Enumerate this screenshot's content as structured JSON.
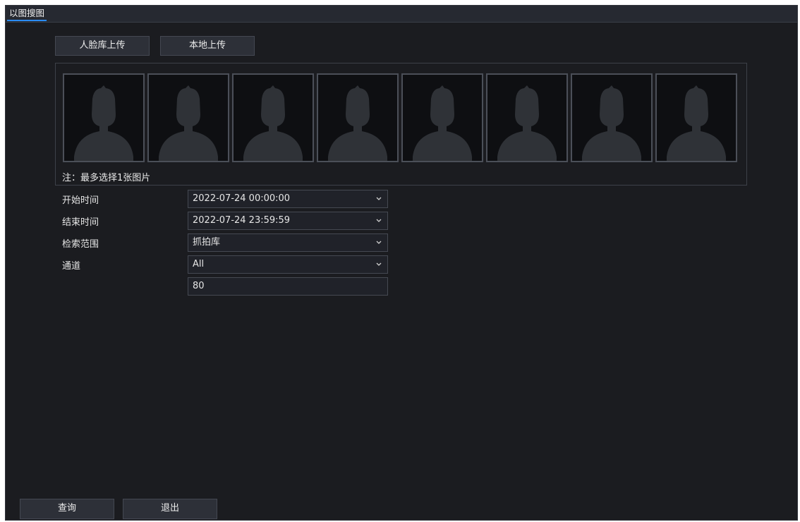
{
  "tab": {
    "label": "以图搜图"
  },
  "upload": {
    "face_lib_label": "人脸库上传",
    "local_label": "本地上传"
  },
  "photos": {
    "slot_count": 8
  },
  "note": "注：最多选择1张图片",
  "form": {
    "start_time": {
      "label": "开始时间",
      "value": "2022-07-24 00:00:00"
    },
    "end_time": {
      "label": "结束时间",
      "value": "2022-07-24 23:59:59"
    },
    "search_scope": {
      "label": "检索范围",
      "value": "抓拍库"
    },
    "channel": {
      "label": "通道",
      "value": "All"
    },
    "similarity": {
      "value": "80"
    }
  },
  "footer": {
    "query_label": "查询",
    "exit_label": "退出"
  },
  "colors": {
    "background": "#1b1c20",
    "tab_accent": "#2a8cff",
    "silhouette": "#2f3237"
  }
}
